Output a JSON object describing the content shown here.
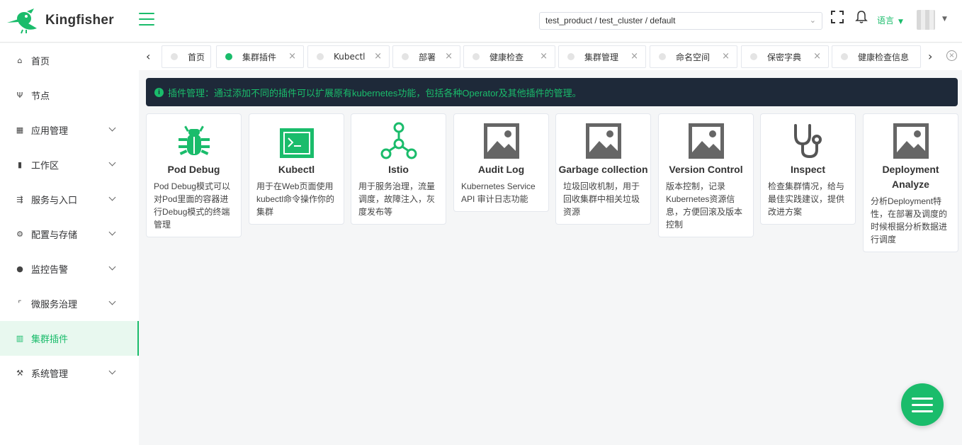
{
  "app": {
    "name": "Kingfisher",
    "accent": "#1abc6b",
    "banner_bg": "#1e2939"
  },
  "header": {
    "cluster_select": "test_product / test_cluster / default",
    "language_label": "语言",
    "icons": [
      "fullscreen-icon",
      "bell-icon"
    ]
  },
  "sidebar": {
    "items": [
      {
        "label": "首页",
        "icon": "home-icon",
        "has_arrow": false,
        "active": false
      },
      {
        "label": "节点",
        "icon": "node-icon",
        "has_arrow": false,
        "active": false
      },
      {
        "label": "应用管理",
        "icon": "grid-icon",
        "has_arrow": true,
        "active": false
      },
      {
        "label": "工作区",
        "icon": "bar-chart-icon",
        "has_arrow": true,
        "active": false
      },
      {
        "label": "服务与入口",
        "icon": "service-icon",
        "has_arrow": true,
        "active": false
      },
      {
        "label": "配置与存储",
        "icon": "gear-icon",
        "has_arrow": true,
        "active": false
      },
      {
        "label": "监控告警",
        "icon": "alert-icon",
        "has_arrow": true,
        "active": false
      },
      {
        "label": "微服务治理",
        "icon": "bracket-icon",
        "has_arrow": true,
        "active": false
      },
      {
        "label": "集群插件",
        "icon": "plugin-icon",
        "has_arrow": false,
        "active": true
      },
      {
        "label": "系统管理",
        "icon": "tools-icon",
        "has_arrow": true,
        "active": false
      }
    ]
  },
  "tabs": [
    {
      "label": "首页",
      "closable": false,
      "active": false
    },
    {
      "label": "集群插件",
      "closable": true,
      "active": true
    },
    {
      "label": "Kubectl",
      "closable": true,
      "active": false
    },
    {
      "label": "部署",
      "closable": true,
      "active": false
    },
    {
      "label": "健康检查",
      "closable": true,
      "active": false
    },
    {
      "label": "集群管理",
      "closable": true,
      "active": false
    },
    {
      "label": "命名空间",
      "closable": true,
      "active": false
    },
    {
      "label": "保密字典",
      "closable": true,
      "active": false
    },
    {
      "label": "健康检查信息",
      "closable": false,
      "active": false
    }
  ],
  "banner": {
    "text": "插件管理：通过添加不同的插件可以扩展原有kubernetes功能，包括各种Operator及其他插件的管理。"
  },
  "plugins": [
    {
      "title": "Pod Debug",
      "icon": "bug-icon",
      "desc": "Pod Debug模式可以对Pod里面的容器进行Debug模式的终端管理"
    },
    {
      "title": "Kubectl",
      "icon": "terminal-icon",
      "desc": "用于在Web页面使用kubectl命令操作你的集群"
    },
    {
      "title": "Istio",
      "icon": "network-icon",
      "desc": "用于服务治理，流量调度，故障注入，灰度发布等"
    },
    {
      "title": "Audit Log",
      "icon": "image-icon",
      "desc": "Kubernetes Service API 审计日志功能"
    },
    {
      "title": "Garbage collection",
      "icon": "image-icon",
      "desc": "垃圾回收机制，用于回收集群中相关垃圾资源"
    },
    {
      "title": "Version Control",
      "icon": "image-icon",
      "desc": "版本控制，记录Kubernetes资源信息，方便回滚及版本控制"
    },
    {
      "title": "Inspect",
      "icon": "stethoscope-icon",
      "desc": "检查集群情况，给与最佳实践建议，提供改进方案"
    },
    {
      "title": "Deployment Analyze",
      "icon": "image-icon",
      "desc": "分析Deployment特性，在部署及调度的时候根据分析数据进行调度"
    }
  ]
}
